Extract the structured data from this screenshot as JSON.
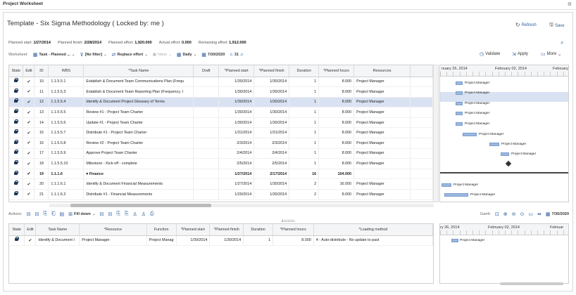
{
  "window": {
    "title": "Project Worksheet"
  },
  "header": {
    "title": "Template - Six Sigma Methodology ( Locked by: me )",
    "refresh_label": "Refresh",
    "save_label": "Save"
  },
  "stats": {
    "planned_start_label": "Planned start:",
    "planned_start": "1/27/2014",
    "planned_finish_label": "Planned finish:",
    "planned_finish": "2/28/2014",
    "planned_effort_label": "Planned effort:",
    "planned_effort": "1,920.000",
    "actual_effort_label": "Actual effort:",
    "actual_effort": "0.000",
    "remaining_effort_label": "Remaining effort:",
    "remaining_effort": "1,912.000"
  },
  "toolbar": {
    "worksheet_label": "Worksheet:",
    "task_planned": "Task - Planned ...",
    "filter": "[No filter]",
    "replace_effort": "Replace effort",
    "none": "None",
    "daily": "Daily",
    "date": "7/30/2020",
    "number": "31",
    "validate": "Validate",
    "apply": "Apply",
    "more": "More"
  },
  "grid1": {
    "columns": [
      "State",
      "Edit",
      "ID",
      "WBS",
      "*Task Name",
      "Draft",
      "*Planned start",
      "*Planned finish",
      "Duration",
      "*Planned hours",
      "Resources"
    ],
    "rows": [
      {
        "id": "10",
        "wbs": "1.1.5.5.1",
        "name": "Establish & Document Team Communications Plan (Frequ",
        "start": "1/30/2014",
        "finish": "1/30/2014",
        "dur": "1",
        "hours": "8.000",
        "res": "Project Manager"
      },
      {
        "id": "11",
        "wbs": "1.1.5.5.3",
        "name": "Establish & Document Team Reporting Plan (Frequency, I",
        "start": "1/30/2014",
        "finish": "1/30/2014",
        "dur": "1",
        "hours": "8.000",
        "res": "Project Manager"
      },
      {
        "id": "12",
        "wbs": "1.1.5.5.4",
        "name": "Identify & Document Project Glossary of Terms",
        "start": "1/30/2014",
        "finish": "1/30/2014",
        "dur": "1",
        "hours": "8.000",
        "res": "Project Manager"
      },
      {
        "id": "13",
        "wbs": "1.1.5.5.5",
        "name": "Review #1 - Project Team Charter",
        "start": "1/30/2014",
        "finish": "1/30/2014",
        "dur": "1",
        "hours": "8.000",
        "res": "Project Manager"
      },
      {
        "id": "14",
        "wbs": "1.1.5.5.6",
        "name": "Update #1 - Project Team Charter",
        "start": "1/30/2014",
        "finish": "1/30/2014",
        "dur": "1",
        "hours": "8.000",
        "res": "Project Manager"
      },
      {
        "id": "15",
        "wbs": "1.1.5.5.7",
        "name": "Distribute #1 - Project Team Charter",
        "start": "1/31/2014",
        "finish": "1/31/2014",
        "dur": "1",
        "hours": "8.000",
        "res": "Project Manager"
      },
      {
        "id": "16",
        "wbs": "1.1.5.5.8",
        "name": "Review #2 - Project Team Charter",
        "start": "2/3/2014",
        "finish": "2/3/2014",
        "dur": "1",
        "hours": "8.000",
        "res": "Project Manager"
      },
      {
        "id": "17",
        "wbs": "1.1.5.5.9",
        "name": "Approve Project Team Charter",
        "start": "2/4/2014",
        "finish": "2/4/2014",
        "dur": "1",
        "hours": "8.000",
        "res": "Project Manager"
      },
      {
        "id": "18",
        "wbs": "1.1.5.5.10",
        "name": "Milestone - Kick-off - complete",
        "start": "2/5/2014",
        "finish": "2/5/2014",
        "dur": "1",
        "hours": "8.000",
        "res": "Project Manager"
      },
      {
        "id": "19",
        "wbs": "1.1.1.6",
        "name": "Finance",
        "start": "1/27/2014",
        "finish": "2/17/2014",
        "dur": "16",
        "hours": "104.000",
        "res": ""
      },
      {
        "id": "20",
        "wbs": "1.1.1.6.1",
        "name": "Identify & Document Financial Measurements",
        "start": "1/27/2014",
        "finish": "1/30/2014",
        "dur": "2",
        "hours": "16.000",
        "res": "Project Manager"
      },
      {
        "id": "21",
        "wbs": "1.1.1.6.2",
        "name": "Distribute #1 - Financial Measurements",
        "start": "1/29/2014",
        "finish": "1/30/2014",
        "dur": "2",
        "hours": "8.000",
        "res": "Project Manager"
      }
    ]
  },
  "gantt1": {
    "date1": "nuary 26, 2014",
    "date2": "February 02, 2014",
    "date3": "February",
    "bar_label": "Project Manager"
  },
  "actions": {
    "label": "Actions:",
    "fill_down": "Fill down",
    "gantt_label": "Gantt:",
    "date": "7/30/2020"
  },
  "grid2": {
    "columns": [
      "State",
      "Edit",
      "Task Name",
      "*Resource",
      "Function",
      "*Planned start",
      "*Planned finish",
      "Duration",
      "*Planned hours",
      "*Loading method"
    ],
    "row": {
      "task": "Identify & Document I",
      "resource": "Project Manager",
      "function": "Project Manag",
      "start": "1/30/2014",
      "finish": "1/30/2014",
      "dur": "1",
      "hours": "8.000",
      "method": "4 - Auto-distribute - No update to past"
    }
  },
  "gantt2": {
    "date1": "ry 26, 2014",
    "date2": "February 02, 2014",
    "date3": "Februar",
    "bar_label": "Project Manager"
  },
  "colors": {
    "accent": "#2a5d9c",
    "selected_row": "#d9e2f2",
    "bar": "#9cb8df"
  }
}
